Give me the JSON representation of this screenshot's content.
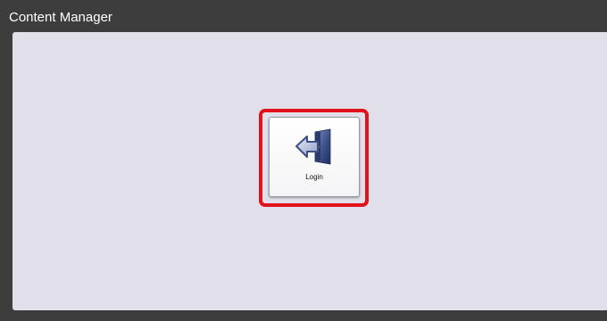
{
  "window": {
    "title": "Content Manager"
  },
  "main": {
    "login_tile": {
      "label": "Login",
      "icon": "login-door-arrow-icon",
      "highlight_color": "#e2121d"
    }
  },
  "colors": {
    "titlebar": "#3d3d3d",
    "panel": "#e1e0e8",
    "icon_blue": "#3b4f86"
  }
}
